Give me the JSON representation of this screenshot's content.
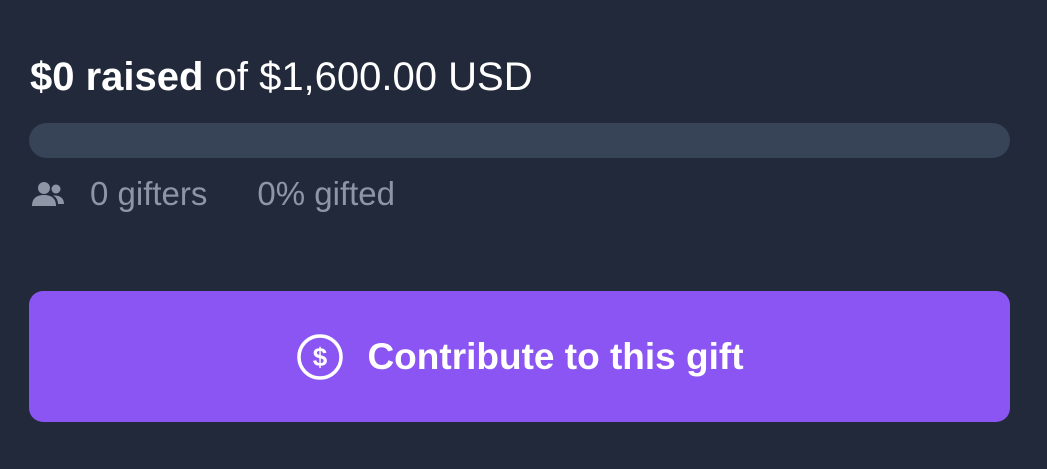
{
  "raised": {
    "amount_text": "$0 raised",
    "goal_text": "of $1,600.00 USD"
  },
  "progress": {
    "percent": 0
  },
  "stats": {
    "gifters_icon": "users-icon",
    "gifters_text": "0 gifters",
    "gifted_text": "0% gifted"
  },
  "contribute_button": {
    "icon": "dollar-circle-icon",
    "label": "Contribute to this gift"
  },
  "colors": {
    "background": "#21293b",
    "track": "#374357",
    "accent": "#8b55f3",
    "muted_text": "#8e96a5"
  }
}
